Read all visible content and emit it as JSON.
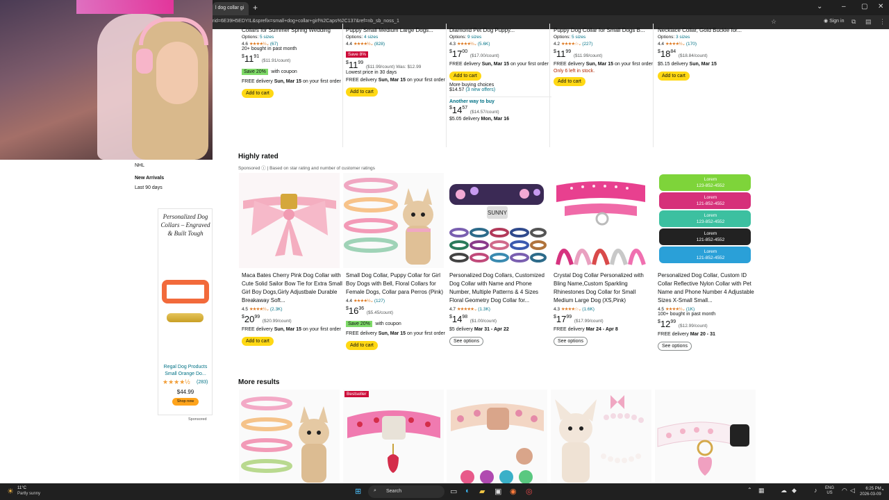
{
  "browser": {
    "tab_title": "l dog collar gi",
    "url": "rid=6E39H5EDYIL&sprefix=small+dog+collar+girl%2Caps%2C137&ref=nb_sb_noss_1",
    "signin": "Sign in"
  },
  "sidebar": {
    "nhl": "NHL",
    "new_arrivals": "New Arrivals",
    "last_90": "Last 90 days",
    "ad": {
      "title": "Personalized Dog Collars – Engraved & Built Tough",
      "brand": "Regal Dog Products Small Orange Do...",
      "rating_count": "(283)",
      "price": "$44.99",
      "shop_now": "Shop now",
      "sponsored": "Sponsored"
    }
  },
  "top_row": [
    {
      "title": "Collars for Summer Spring Wedding",
      "options": "5 sizes",
      "rating": "4.6",
      "count": "(67)",
      "bought": "20+ bought in past month",
      "price_whole": "11",
      "price_frac": "91",
      "unit": "($11.91/count)",
      "save": "Save 20%",
      "save_label": "with coupon",
      "delivery_pre": "FREE delivery",
      "delivery_date": "Sun, Mar 15",
      "delivery_post": "on your first order",
      "button": "Add to cart"
    },
    {
      "title": "Puppy Small Medium Large Dogs...",
      "options": "4 sizes",
      "rating": "4.4",
      "count": "(828)",
      "tag": "Save 8%",
      "price_whole": "11",
      "price_frac": "99",
      "unit": "($11.99/count) Was: $12.99",
      "lowest": "Lowest price in 30 days",
      "delivery_pre": "FREE delivery",
      "delivery_date": "Sun, Mar 15",
      "delivery_post": "on your first order",
      "button": "Add to cart"
    },
    {
      "title": "Diamond Pet Dog Puppy...",
      "options": "9 sizes",
      "rating": "4.3",
      "count": "(5.6K)",
      "price_whole": "17",
      "price_frac": "00",
      "unit": "($17.00/count)",
      "delivery_pre": "FREE delivery",
      "delivery_date": "Sun, Mar 15",
      "delivery_post": "on your first order",
      "button": "Add to cart",
      "more_buying": "More buying choices",
      "more_price": "$14.57",
      "more_offers": "(3 new offers)",
      "another_way": "Another way to buy",
      "alt_whole": "14",
      "alt_frac": "57",
      "alt_unit": "($14.57/count)",
      "alt_delivery_pre": "$5.05 delivery",
      "alt_delivery_date": "Mon, Mar 16"
    },
    {
      "title": "Puppy Dog Collar for Small Dogs B...",
      "options": "5 sizes",
      "rating": "4.2",
      "count": "(227)",
      "price_whole": "11",
      "price_frac": "99",
      "unit": "($11.99/count)",
      "delivery_pre": "FREE delivery",
      "delivery_date": "Sun, Mar 15",
      "delivery_post": "on your first order",
      "stock": "Only 6 left in stock.",
      "button": "Add to cart"
    },
    {
      "title": "Necklace Collar, Gold Buckle for...",
      "options": "3 sizes",
      "rating": "4.4",
      "count": "(170)",
      "price_whole": "18",
      "price_frac": "84",
      "unit": "($18.84/count)",
      "delivery_pre": "$5.15 delivery",
      "delivery_date": "Sun, Mar 15",
      "button": "Add to cart"
    }
  ],
  "highly_rated": {
    "heading": "Highly rated",
    "sponsored": "Sponsored",
    "subtitle": "| Based on star rating and number of customer ratings",
    "items": [
      {
        "title": "Maca Bates Cherry Pink Dog Collar with Cute Solid Sailor Bow Tie for Extra Small Girl Boy Dogs,Girly Adjustbale Durable Breakaway Soft...",
        "rating": "4.5",
        "count": "(2.3K)",
        "price_whole": "20",
        "price_frac": "99",
        "unit": "($20.99/count)",
        "delivery_pre": "FREE delivery",
        "delivery_date": "Sun, Mar 15",
        "delivery_post": "on your first order",
        "button": "Add to cart"
      },
      {
        "title": "Small Dog Collar, Puppy Collar for Girl Boy Dogs with Bell, Floral Collars for Female Dogs, Collar para Perros (Pink)",
        "rating": "4.4",
        "count": "(127)",
        "price_whole": "16",
        "price_frac": "36",
        "unit": "($5.45/count)",
        "save": "Save 20%",
        "save_label": "with coupon",
        "delivery_pre": "FREE delivery",
        "delivery_date": "Sun, Mar 15",
        "delivery_post": "on your first order",
        "button": "Add to cart"
      },
      {
        "title": "Personalized Dog Collars, Customized Dog Collar with Name and Phone Number, Multiple Patterns & 4 Sizes Floral Geometry Dog Collar for...",
        "rating": "4.7",
        "count": "(1.3K)",
        "price_whole": "14",
        "price_frac": "98",
        "unit": "($1.00/count)",
        "delivery_pre": "$5 delivery",
        "delivery_date": "Mar 31 - Apr 22",
        "button": "See options",
        "img_label": "SUNNY"
      },
      {
        "title": "Crystal Dog Collar Personalized with Bling Name,Custom Sparkling Rhinestones Dog Collar for Small Medium Large Dog (XS,Pink)",
        "rating": "4.3",
        "count": "(1.6K)",
        "price_whole": "17",
        "price_frac": "99",
        "unit": "($17.99/count)",
        "delivery_pre": "FREE delivery",
        "delivery_date": "Mar 24 - Apr 8",
        "button": "See options"
      },
      {
        "title": "Personalized Dog Collar, Custom ID Collar Reflective Nylon Collar with Pet Name and Phone Number 4 Adjustable Sizes X-Small Small...",
        "rating": "4.5",
        "count": "(1K)",
        "bought": "100+ bought in past month",
        "price_whole": "12",
        "price_frac": "99",
        "unit": "($12.99/count)",
        "delivery_pre": "FREE delivery",
        "delivery_date": "Mar 20 - 31",
        "button": "See options",
        "img_labels": [
          "Lorem",
          "123-852-4552",
          "Lorem",
          "121-852-4552",
          "Lorem",
          "123-852-4552",
          "Lorem",
          "121-852-4552",
          "Lorem",
          "121-852-4552"
        ]
      }
    ]
  },
  "more_results": {
    "heading": "More results",
    "bestseller": "Bestseller"
  },
  "taskbar": {
    "temp": "11°C",
    "weather": "Partly sunny",
    "search": "Search",
    "lang1": "ENG",
    "lang2": "US",
    "time": "6:25 PM",
    "date": "2026-03-09"
  },
  "colors": {
    "add_to_cart": "#ffd814",
    "link": "#007185",
    "star": "#de7921",
    "save_badge": "#7fda69",
    "deal_tag": "#cc0c39"
  }
}
